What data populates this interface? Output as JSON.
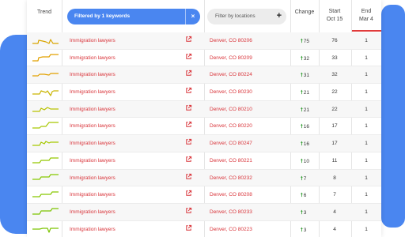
{
  "header": {
    "trend": "Trend",
    "keyword_filter": "Filtered by 1 keywords",
    "keyword_filter_clear": "×",
    "location_filter": "Filter by locations",
    "location_filter_add": "+",
    "change": "Change",
    "start_line1": "Start",
    "start_line2": "Oct 15",
    "end_line1": "End",
    "end_line2": "Mar 4"
  },
  "colors": {
    "accent": "#4a86f0",
    "link": "#d9343a",
    "up": "#2e9b2e",
    "end_underline": "#e03b3b"
  },
  "rows": [
    {
      "keyword": "Immigration lawyers",
      "location": "Denver, CO 80206",
      "change": "75",
      "start": "76",
      "end": "1",
      "trend_color": "#d9a400"
    },
    {
      "keyword": "Immigration lawyers",
      "location": "Denver, CO 80209",
      "change": "32",
      "start": "33",
      "end": "1",
      "trend_color": "#e2a100"
    },
    {
      "keyword": "Immigration lawyers",
      "location": "Denver, CO 80224",
      "change": "31",
      "start": "32",
      "end": "1",
      "trend_color": "#e2a100"
    },
    {
      "keyword": "Immigration lawyers",
      "location": "Denver, CO 80230",
      "change": "21",
      "start": "22",
      "end": "1",
      "trend_color": "#c9b400"
    },
    {
      "keyword": "Immigration lawyers",
      "location": "Denver, CO 80210",
      "change": "21",
      "start": "22",
      "end": "1",
      "trend_color": "#b9c200"
    },
    {
      "keyword": "Immigration lawyers",
      "location": "Denver, CO 80220",
      "change": "16",
      "start": "17",
      "end": "1",
      "trend_color": "#a6c800"
    },
    {
      "keyword": "Immigration lawyers",
      "location": "Denver, CO 80247",
      "change": "16",
      "start": "17",
      "end": "1",
      "trend_color": "#a6c800"
    },
    {
      "keyword": "Immigration lawyers",
      "location": "Denver, CO 80221",
      "change": "10",
      "start": "11",
      "end": "1",
      "trend_color": "#94c800"
    },
    {
      "keyword": "Immigration lawyers",
      "location": "Denver, CO 80232",
      "change": "7",
      "start": "8",
      "end": "1",
      "trend_color": "#86c800"
    },
    {
      "keyword": "Immigration lawyers",
      "location": "Denver, CO 80208",
      "change": "6",
      "start": "7",
      "end": "1",
      "trend_color": "#86c800"
    },
    {
      "keyword": "Immigration lawyers",
      "location": "Denver, CO 80233",
      "change": "3",
      "start": "4",
      "end": "1",
      "trend_color": "#7cc400"
    },
    {
      "keyword": "Immigration lawyers",
      "location": "Denver, CO 80223",
      "change": "3",
      "start": "4",
      "end": "1",
      "trend_color": "#7cc400"
    }
  ]
}
